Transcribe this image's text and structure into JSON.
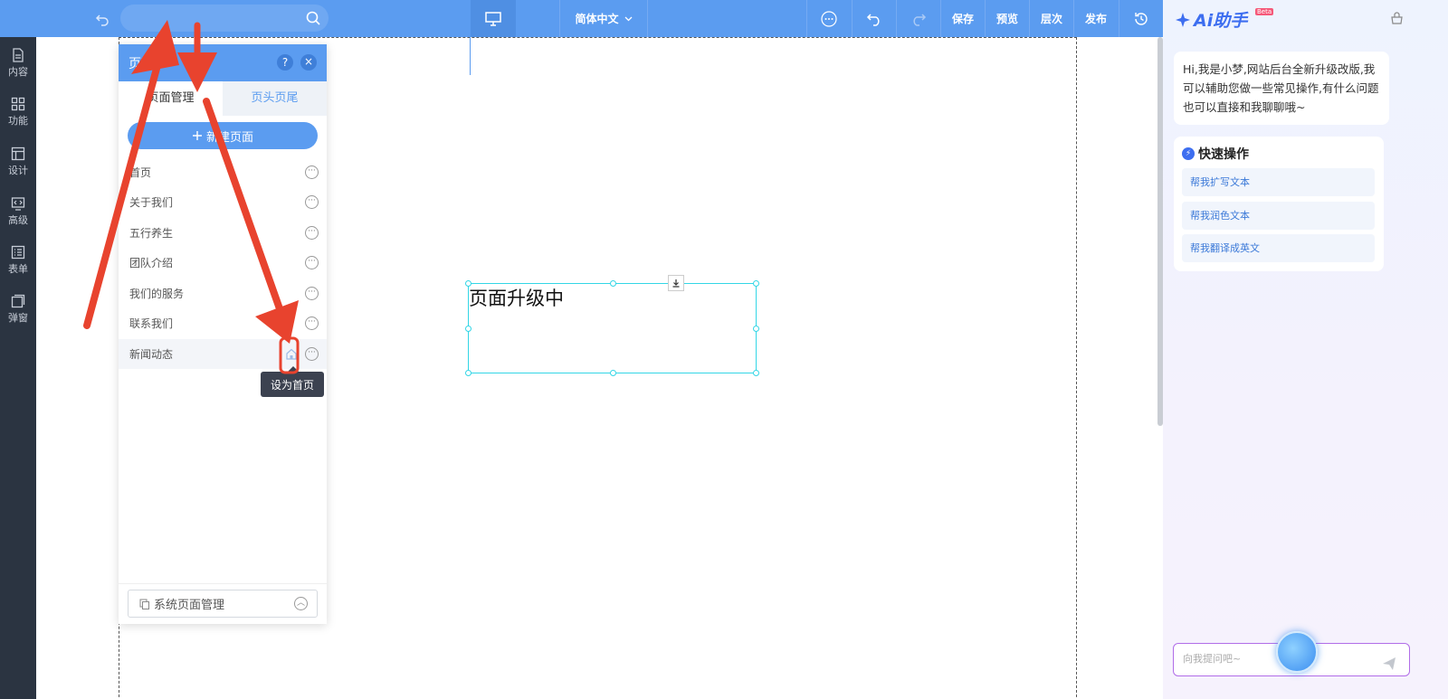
{
  "toolbar": {
    "language": "简体中文",
    "save": "保存",
    "preview": "预览",
    "layers": "层次",
    "publish": "发布"
  },
  "left_nav": [
    {
      "label": "内容",
      "icon": "document-icon"
    },
    {
      "label": "功能",
      "icon": "grid-icon"
    },
    {
      "label": "设计",
      "icon": "layout-icon"
    },
    {
      "label": "高级",
      "icon": "code-icon"
    },
    {
      "label": "表单",
      "icon": "form-icon"
    },
    {
      "label": "弹窗",
      "icon": "popup-icon"
    }
  ],
  "canvas": {
    "text_box": "页面升级中"
  },
  "page_panel": {
    "title": "页面",
    "help": "?",
    "close": "×",
    "tabs": [
      "页面管理",
      "页头页尾"
    ],
    "new_page": "新建页面",
    "pages": [
      "首页",
      "关于我们",
      "五行养生",
      "团队介绍",
      "我们的服务",
      "联系我们",
      "新闻动态"
    ],
    "system_page": "系统页面管理",
    "tooltip": "设为首页"
  },
  "ai": {
    "logo": "Ai助手",
    "beta": "Beta",
    "greeting": "Hi,我是小梦,网站后台全新升级改版,我可以辅助您做一些常见操作,有什么问题也可以直接和我聊聊哦~",
    "quick_title": "快速操作",
    "quick_actions": [
      "帮我扩写文本",
      "帮我润色文本",
      "帮我翻译成英文"
    ],
    "input_placeholder": "向我提问吧~"
  },
  "colors": {
    "toolbar": "#5b9cf0",
    "left_nav": "#2b3441",
    "annotation_arrow": "#e8432e",
    "selection": "#33d6e6"
  }
}
